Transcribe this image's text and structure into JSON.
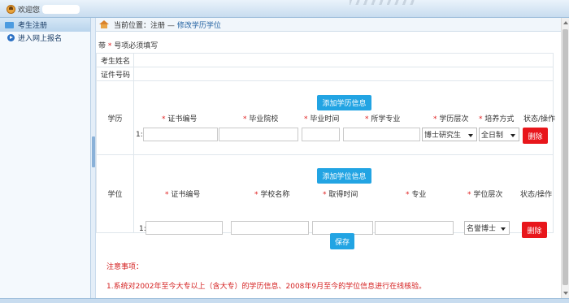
{
  "topbar": {
    "welcome": "欢迎您"
  },
  "sidebar": {
    "header": "考生注册",
    "items": [
      {
        "label": "进入网上报名"
      }
    ]
  },
  "breadcrumb": {
    "prefix": "当前位置：注册 —",
    "current": "修改学历学位"
  },
  "form": {
    "required_note_pre": "带",
    "required_note_star": "*",
    "required_note_post": "号项必须填写",
    "name_label": "考生姓名",
    "id_label": "证件号码",
    "education": {
      "label": "学历",
      "add_button": "添加学历信息",
      "columns": [
        "证书编号",
        "毕业院校",
        "毕业时间",
        "所学专业",
        "学历层次",
        "培养方式"
      ],
      "status_column": "状态/操作",
      "row_index": "1:",
      "level_value": "博士研究生",
      "mode_value": "全日制",
      "delete_button": "删除"
    },
    "degree": {
      "label": "学位",
      "add_button": "添加学位信息",
      "columns": [
        "证书编号",
        "学校名称",
        "取得时间",
        "专业",
        "学位层次"
      ],
      "status_column": "状态/操作",
      "row_index": "1:",
      "level_value": "名誉博士",
      "delete_button": "删除"
    },
    "save_button": "保存"
  },
  "notice": {
    "title": "注意事项：",
    "items": [
      "1.系统对2002年至今大专以上（含大专）的学历信息、2008年9月至今的学位信息进行在线核验。"
    ]
  }
}
